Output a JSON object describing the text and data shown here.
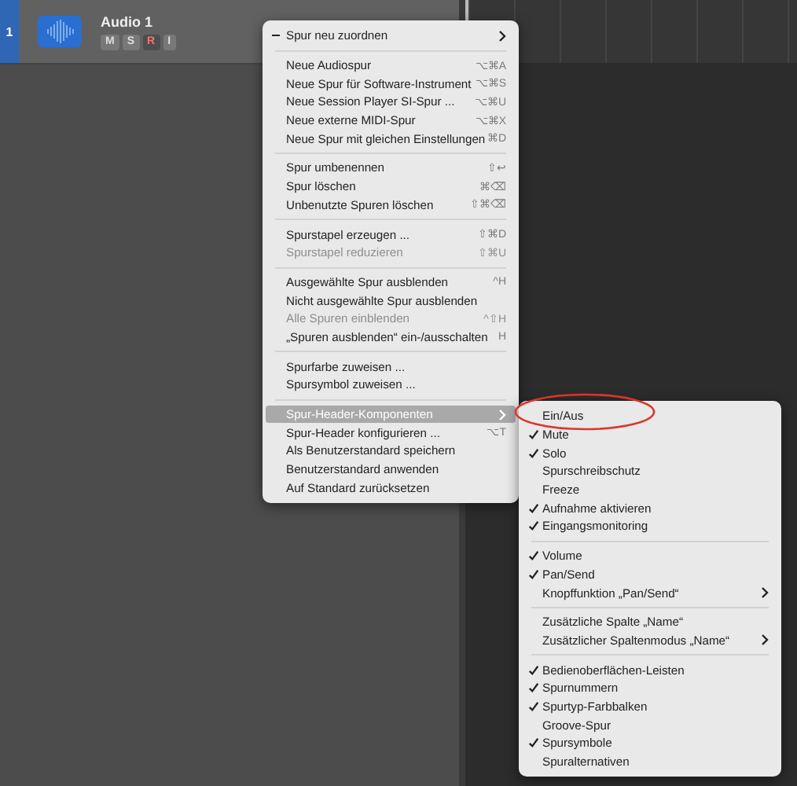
{
  "track": {
    "number": "1",
    "name": "Audio 1",
    "selected": true,
    "buttons": [
      {
        "label": "M",
        "kind": "mute"
      },
      {
        "label": "S",
        "kind": "solo"
      },
      {
        "label": "R",
        "kind": "record"
      },
      {
        "label": "I",
        "kind": "input"
      }
    ]
  },
  "context_menu": {
    "groups": [
      [
        {
          "label": "Spur neu zuordnen",
          "mixed": true,
          "submenu": true,
          "disabled": false,
          "selected": false
        }
      ],
      [
        {
          "label": "Neue Audiospur",
          "shortcut": "⌥⌘A",
          "disabled": false,
          "selected": false
        },
        {
          "label": "Neue Spur für Software-Instrument",
          "shortcut": "⌥⌘S",
          "disabled": false,
          "selected": false
        },
        {
          "label": "Neue Session Player SI-Spur ...",
          "shortcut": "⌥⌘U",
          "disabled": false,
          "selected": false
        },
        {
          "label": "Neue externe MIDI-Spur",
          "shortcut": "⌥⌘X",
          "disabled": false,
          "selected": false
        },
        {
          "label": "Neue Spur mit gleichen Einstellungen",
          "shortcut": "⌘D",
          "disabled": false,
          "selected": false
        }
      ],
      [
        {
          "label": "Spur umbenennen",
          "shortcut": "⇧↩",
          "disabled": false,
          "selected": false
        },
        {
          "label": "Spur löschen",
          "shortcut": "⌘⌫",
          "disabled": false,
          "selected": false
        },
        {
          "label": "Unbenutzte Spuren löschen",
          "shortcut": "⇧⌘⌫",
          "disabled": false,
          "selected": false
        }
      ],
      [
        {
          "label": "Spurstapel erzeugen ...",
          "shortcut": "⇧⌘D",
          "disabled": false,
          "selected": false
        },
        {
          "label": "Spurstapel reduzieren",
          "shortcut": "⇧⌘U",
          "disabled": true,
          "selected": false
        }
      ],
      [
        {
          "label": "Ausgewählte Spur ausblenden",
          "shortcut": "^H",
          "disabled": false,
          "selected": false
        },
        {
          "label": "Nicht ausgewählte Spur ausblenden",
          "disabled": false,
          "selected": false
        },
        {
          "label": "Alle Spuren einblenden",
          "shortcut": "^⇧H",
          "disabled": true,
          "selected": false
        },
        {
          "label": "„Spuren ausblenden“ ein-/ausschalten",
          "shortcut": "H",
          "disabled": false,
          "selected": false
        }
      ],
      [
        {
          "label": "Spurfarbe zuweisen ...",
          "disabled": false,
          "selected": false
        },
        {
          "label": "Spursymbol zuweisen ...",
          "disabled": false,
          "selected": false
        }
      ],
      [
        {
          "label": "Spur-Header-Komponenten",
          "submenu": true,
          "disabled": false,
          "selected": true
        },
        {
          "label": "Spur-Header konfigurieren ...",
          "shortcut": "⌥T",
          "disabled": false,
          "selected": false
        },
        {
          "label": "Als Benutzerstandard speichern",
          "disabled": false,
          "selected": false
        },
        {
          "label": "Benutzerstandard anwenden",
          "disabled": false,
          "selected": false
        },
        {
          "label": "Auf Standard zurücksetzen",
          "disabled": false,
          "selected": false
        }
      ]
    ]
  },
  "submenu": {
    "groups": [
      [
        {
          "label": "Ein/Aus",
          "checked": false,
          "circled": true
        },
        {
          "label": "Mute",
          "checked": true
        },
        {
          "label": "Solo",
          "checked": true
        },
        {
          "label": "Spurschreibschutz",
          "checked": false
        },
        {
          "label": "Freeze",
          "checked": false
        },
        {
          "label": "Aufnahme aktivieren",
          "checked": true
        },
        {
          "label": "Eingangsmonitoring",
          "checked": true
        }
      ],
      [
        {
          "label": "Volume",
          "checked": true
        },
        {
          "label": "Pan/Send",
          "checked": true
        },
        {
          "label": "Knopffunktion „Pan/Send“",
          "checked": false,
          "submenu": true
        }
      ],
      [
        {
          "label": "Zusätzliche Spalte „Name“",
          "checked": false
        },
        {
          "label": "Zusätzlicher Spaltenmodus „Name“",
          "checked": false,
          "submenu": true
        }
      ],
      [
        {
          "label": "Bedienoberflächen-Leisten",
          "checked": true
        },
        {
          "label": "Spurnummern",
          "checked": true
        },
        {
          "label": "Spurtyp-Farbbalken",
          "checked": true
        },
        {
          "label": "Groove-Spur",
          "checked": false
        },
        {
          "label": "Spursymbole",
          "checked": true
        },
        {
          "label": "Spuralternativen",
          "checked": false
        }
      ]
    ]
  }
}
